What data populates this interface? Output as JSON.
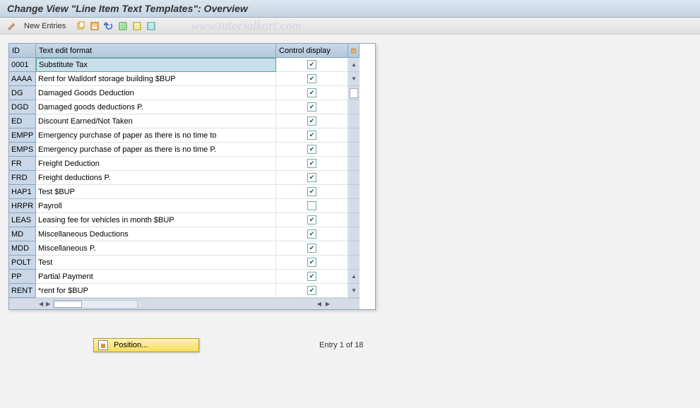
{
  "title": "Change View \"Line Item Text Templates\": Overview",
  "toolbar": {
    "new_entries": "New Entries"
  },
  "watermark": "www.tutorialkart.com",
  "table": {
    "headers": {
      "id": "ID",
      "text": "Text edit format",
      "control": "Control display"
    },
    "rows": [
      {
        "id": "0001",
        "text": "Substitute Tax",
        "checked": true,
        "selected": true
      },
      {
        "id": "AAAA",
        "text": "Rent for Walldorf storage building $BUP",
        "checked": true
      },
      {
        "id": "DG",
        "text": "Damaged Goods Deduction",
        "checked": true
      },
      {
        "id": "DGD",
        "text": "Damaged goods deductions P.",
        "checked": true
      },
      {
        "id": "ED",
        "text": "Discount Earned/Not Taken",
        "checked": true
      },
      {
        "id": "EMPP",
        "text": "Emergency purchase of paper as there is no time to",
        "checked": true
      },
      {
        "id": "EMPS",
        "text": "Emergency purchase of paper as there is no time P.",
        "checked": true
      },
      {
        "id": "FR",
        "text": "Freight Deduction",
        "checked": true
      },
      {
        "id": "FRD",
        "text": "Freight deductions P.",
        "checked": true
      },
      {
        "id": "HAP1",
        "text": "Test $BUP",
        "checked": true
      },
      {
        "id": "HRPR",
        "text": "Payroll",
        "checked": false
      },
      {
        "id": "LEAS",
        "text": "Leasing fee for vehicles in month $BUP",
        "checked": true
      },
      {
        "id": "MD",
        "text": "Miscellaneous Deductions",
        "checked": true
      },
      {
        "id": "MDD",
        "text": "Miscellaneous P.",
        "checked": true
      },
      {
        "id": "POLT",
        "text": "Test",
        "checked": true
      },
      {
        "id": "PP",
        "text": "Partial Payment",
        "checked": true
      },
      {
        "id": "RENT",
        "text": "*rent for $BUP",
        "checked": true
      }
    ]
  },
  "footer": {
    "position_label": "Position...",
    "entry_label": "Entry 1 of 18",
    "total_entries": 18,
    "current_entry": 1
  },
  "icons": {
    "pencil": "✎",
    "copy": "⧉",
    "export": "▤",
    "undo": "↶",
    "select_all": "▦",
    "sheet": "▥",
    "sheet2": "▧",
    "config": "▦"
  }
}
